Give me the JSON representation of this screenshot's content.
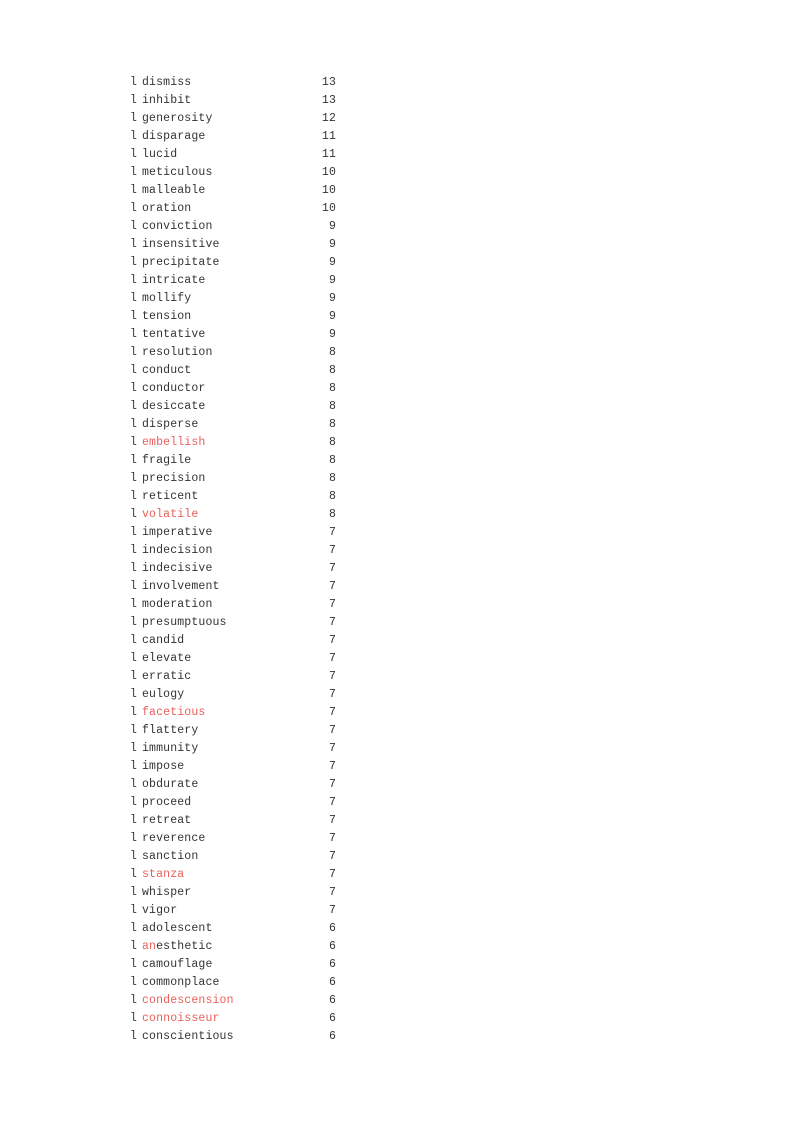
{
  "document": {
    "page_background": "#ffffff",
    "text_color": "#333333",
    "highlight_color": "#e8605a",
    "marker_glyph": "l"
  },
  "list": {
    "rows": [
      {
        "marker": "l",
        "word": "dismiss",
        "count": "13",
        "highlight": "none"
      },
      {
        "marker": "l",
        "word": "inhibit",
        "count": "13",
        "highlight": "none"
      },
      {
        "marker": "l",
        "word": "generosity",
        "count": "12",
        "highlight": "none"
      },
      {
        "marker": "l",
        "word": "disparage",
        "count": "11",
        "highlight": "none"
      },
      {
        "marker": "l",
        "word": "lucid",
        "count": "11",
        "highlight": "none"
      },
      {
        "marker": "l",
        "word": "meticulous",
        "count": "10",
        "highlight": "none"
      },
      {
        "marker": "l",
        "word": "malleable",
        "count": "10",
        "highlight": "none"
      },
      {
        "marker": "l",
        "word": "oration",
        "count": "10",
        "highlight": "none"
      },
      {
        "marker": "l",
        "word": "conviction",
        "count": "9",
        "highlight": "none"
      },
      {
        "marker": "l",
        "word": "insensitive",
        "count": "9",
        "highlight": "none"
      },
      {
        "marker": "l",
        "word": "precipitate",
        "count": "9",
        "highlight": "none"
      },
      {
        "marker": "l",
        "word": "intricate",
        "count": "9",
        "highlight": "none"
      },
      {
        "marker": "l",
        "word": "mollify",
        "count": "9",
        "highlight": "none"
      },
      {
        "marker": "l",
        "word": "tension",
        "count": "9",
        "highlight": "none"
      },
      {
        "marker": "l",
        "word": "tentative",
        "count": "9",
        "highlight": "none"
      },
      {
        "marker": "l",
        "word": "resolution",
        "count": "8",
        "highlight": "none"
      },
      {
        "marker": "l",
        "word": "conduct",
        "count": "8",
        "highlight": "none"
      },
      {
        "marker": "l",
        "word": "conductor",
        "count": "8",
        "highlight": "none"
      },
      {
        "marker": "l",
        "word": "desiccate",
        "count": "8",
        "highlight": "none"
      },
      {
        "marker": "l",
        "word": "disperse",
        "count": "8",
        "highlight": "none"
      },
      {
        "marker": "l",
        "word": "embellish",
        "count": "8",
        "highlight": "full"
      },
      {
        "marker": "l",
        "word": "fragile",
        "count": "8",
        "highlight": "none"
      },
      {
        "marker": "l",
        "word": "precision",
        "count": "8",
        "highlight": "none"
      },
      {
        "marker": "l",
        "word": "reticent",
        "count": "8",
        "highlight": "none"
      },
      {
        "marker": "l",
        "word": "volatile",
        "count": "8",
        "highlight": "full"
      },
      {
        "marker": "l",
        "word": "imperative",
        "count": "7",
        "highlight": "none"
      },
      {
        "marker": "l",
        "word": "indecision",
        "count": "7",
        "highlight": "none"
      },
      {
        "marker": "l",
        "word": "indecisive",
        "count": "7",
        "highlight": "none"
      },
      {
        "marker": "l",
        "word": "involvement",
        "count": "7",
        "highlight": "none"
      },
      {
        "marker": "l",
        "word": "moderation",
        "count": "7",
        "highlight": "none"
      },
      {
        "marker": "l",
        "word": "presumptuous",
        "count": "7",
        "highlight": "none"
      },
      {
        "marker": "l",
        "word": "candid",
        "count": "7",
        "highlight": "none"
      },
      {
        "marker": "l",
        "word": "elevate",
        "count": "7",
        "highlight": "none"
      },
      {
        "marker": "l",
        "word": "erratic",
        "count": "7",
        "highlight": "none"
      },
      {
        "marker": "l",
        "word": "eulogy",
        "count": "7",
        "highlight": "none"
      },
      {
        "marker": "l",
        "word": "facetious",
        "count": "7",
        "highlight": "full"
      },
      {
        "marker": "l",
        "word": "flattery",
        "count": "7",
        "highlight": "none"
      },
      {
        "marker": "l",
        "word": "immunity",
        "count": "7",
        "highlight": "none"
      },
      {
        "marker": "l",
        "word": "impose",
        "count": "7",
        "highlight": "none"
      },
      {
        "marker": "l",
        "word": "obdurate",
        "count": "7",
        "highlight": "none"
      },
      {
        "marker": "l",
        "word": "proceed",
        "count": "7",
        "highlight": "none"
      },
      {
        "marker": "l",
        "word": "retreat",
        "count": "7",
        "highlight": "none"
      },
      {
        "marker": "l",
        "word": "reverence",
        "count": "7",
        "highlight": "none"
      },
      {
        "marker": "l",
        "word": "sanction",
        "count": "7",
        "highlight": "none"
      },
      {
        "marker": "l",
        "word": "stanza",
        "count": "7",
        "highlight": "full"
      },
      {
        "marker": "l",
        "word": "whisper",
        "count": "7",
        "highlight": "none"
      },
      {
        "marker": "l",
        "word": "vigor",
        "count": "7",
        "highlight": "none"
      },
      {
        "marker": "l",
        "word": "adolescent",
        "count": "6",
        "highlight": "none"
      },
      {
        "marker": "l",
        "word": "anesthetic",
        "count": "6",
        "highlight": "partial",
        "highlight_prefix": "an",
        "highlight_rest": "esthetic"
      },
      {
        "marker": "l",
        "word": "camouflage",
        "count": "6",
        "highlight": "none"
      },
      {
        "marker": "l",
        "word": "commonplace",
        "count": "6",
        "highlight": "none"
      },
      {
        "marker": "l",
        "word": "condescension",
        "count": "6",
        "highlight": "full"
      },
      {
        "marker": "l",
        "word": "connoisseur",
        "count": "6",
        "highlight": "full"
      },
      {
        "marker": "l",
        "word": "conscientious",
        "count": "6",
        "highlight": "none"
      }
    ]
  }
}
